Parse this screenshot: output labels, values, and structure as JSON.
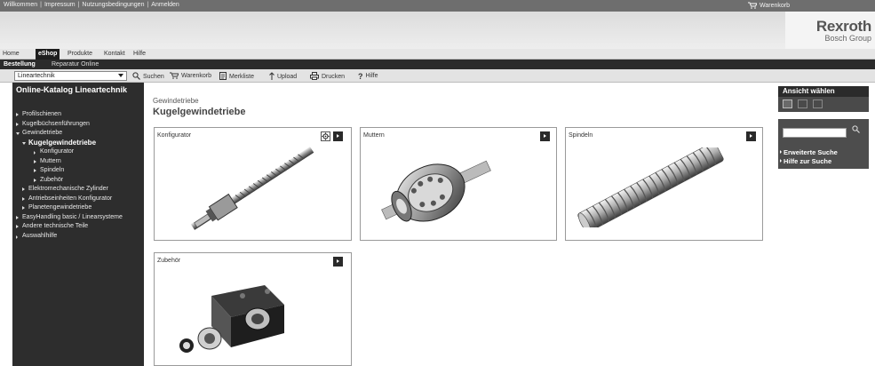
{
  "topbar": {
    "links": [
      "Willkommen",
      "Impressum",
      "Nutzungsbedingungen",
      "Anmelden"
    ],
    "cart_label": "Warenkorb"
  },
  "logo": {
    "line1": "Rexroth",
    "line2": "Bosch Group"
  },
  "mainnav": [
    "Home",
    "eShop",
    "Produkte",
    "Kontakt",
    "Hilfe"
  ],
  "subnav": [
    "Bestellung",
    "Reparatur Online"
  ],
  "toolbar": {
    "catalog_select": "Lineartechnik",
    "search": "Suchen",
    "cart": "Warenkorb",
    "watchlist": "Merkliste",
    "upload": "Upload",
    "print": "Drucken",
    "help": "Hilfe"
  },
  "sidebar": {
    "title": "Online-Katalog Lineartechnik",
    "items": [
      "Profilschienen",
      "Kugelbüchsenführungen",
      "Gewindetriebe",
      "Kugelgewindetriebe",
      "Konfigurator",
      "Muttern",
      "Spindeln",
      "Zubehör",
      "Elektromechanische Zylinder",
      "Antriebseinheiten Konfigurator",
      "Planetengewindetriebe",
      "EasyHandling basic / Linearsysteme",
      "Andere technische Teile",
      "Auswahlhilfe"
    ]
  },
  "content": {
    "breadcrumb": "Gewindetriebe",
    "title": "Kugelgewindetriebe",
    "cards": [
      "Konfigurator",
      "Muttern",
      "Spindeln",
      "Zubehör"
    ]
  },
  "right_panel": {
    "view_title": "Ansicht wählen",
    "advanced_search": "Erweiterte Suche",
    "search_help": "Hilfe zur Suche"
  },
  "colors": {
    "dark": "#2b2b2b",
    "topbar": "#6e6e6e",
    "accent_text": "#ffffff"
  }
}
